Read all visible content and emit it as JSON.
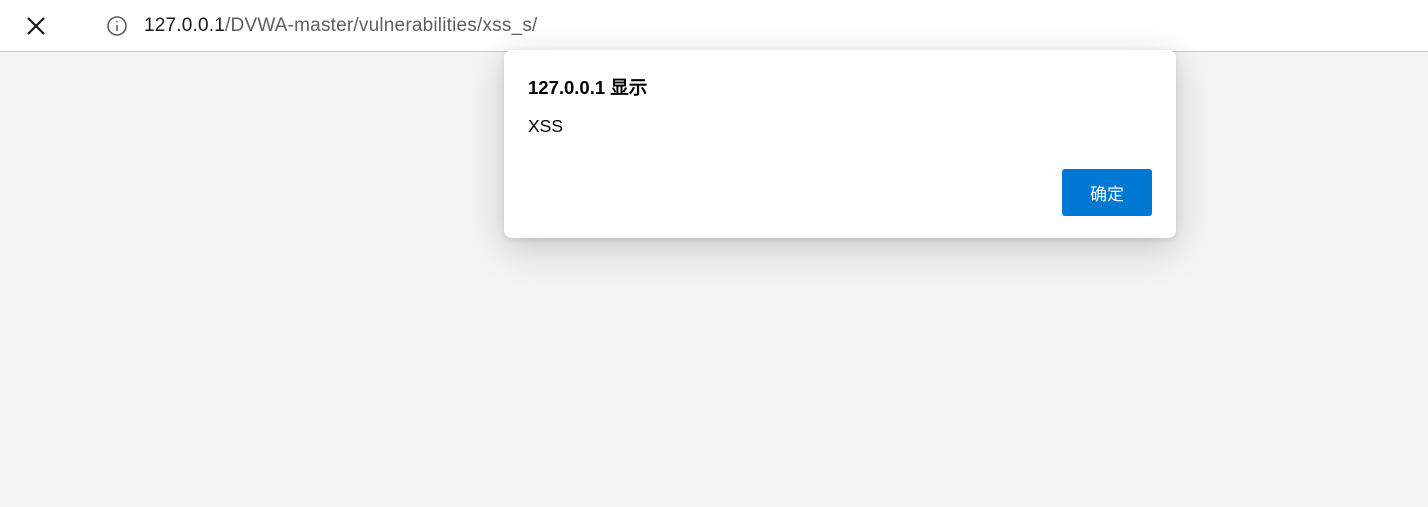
{
  "address_bar": {
    "url_host": "127.0.0.1",
    "url_path": "/DVWA-master/vulnerabilities/xss_s/"
  },
  "dialog": {
    "title": "127.0.0.1 显示",
    "message": "XSS",
    "ok_label": "确定"
  }
}
